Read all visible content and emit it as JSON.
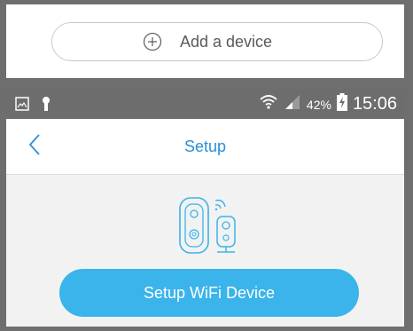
{
  "add_device": {
    "label": "Add a device",
    "icon": "plus-circle-icon"
  },
  "status_bar": {
    "battery_percent": "42%",
    "time": "15:06",
    "icons": [
      "gallery-icon",
      "keyhole-icon",
      "wifi-icon",
      "signal-icon",
      "battery-charging-icon"
    ]
  },
  "nav": {
    "title": "Setup",
    "back_icon": "chevron-left-icon"
  },
  "setup_button": {
    "label": "Setup WiFi Device"
  },
  "colors": {
    "accent": "#3ab4ea",
    "title": "#2a8fd8",
    "status_bar": "#6d6d6d"
  }
}
